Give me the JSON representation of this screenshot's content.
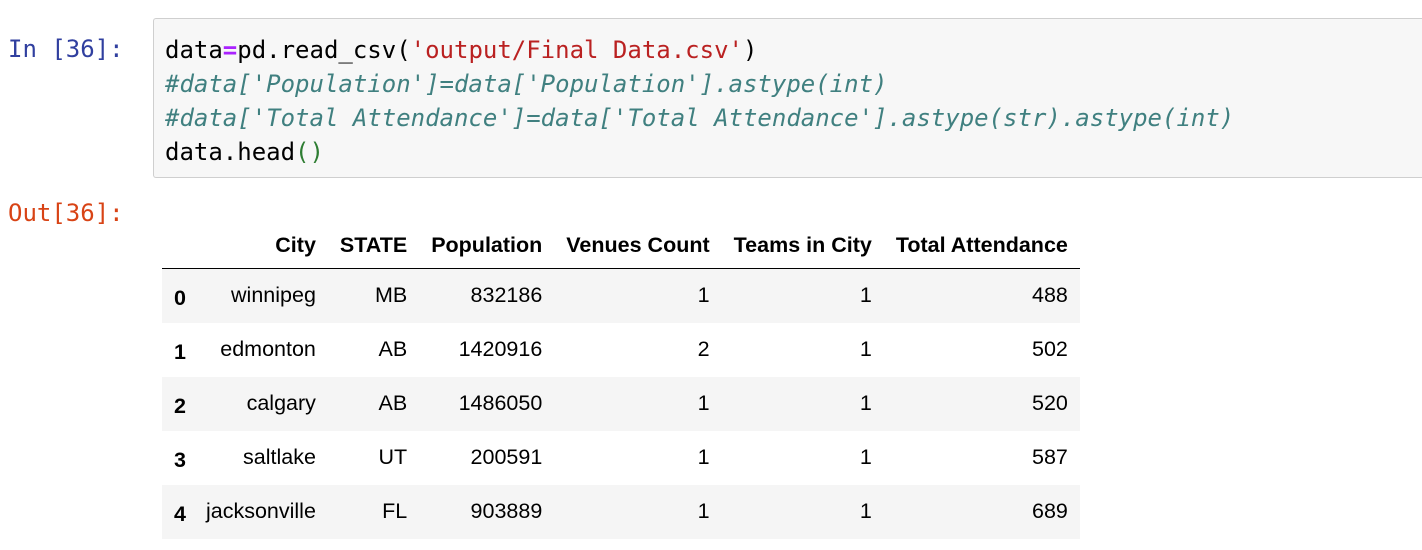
{
  "cell": {
    "in_prompt": "In [36]:",
    "out_prompt": "Out[36]:",
    "code": {
      "line1": {
        "a": "data",
        "op": "=",
        "b": "pd.read_csv(",
        "str": "'output/Final Data.csv'",
        "c": ")"
      },
      "line2": "#data['Population']=data['Population'].astype(int)",
      "line3": "#data['Total Attendance']=data['Total Attendance'].astype(str).astype(int)",
      "line4": {
        "a": "data.head",
        "paren": "()"
      }
    }
  },
  "table": {
    "columns": [
      "",
      "City",
      "STATE",
      "Population",
      "Venues Count",
      "Teams in City",
      "Total Attendance"
    ],
    "rows": [
      [
        "0",
        "winnipeg",
        "MB",
        "832186",
        "1",
        "1",
        "488"
      ],
      [
        "1",
        "edmonton",
        "AB",
        "1420916",
        "2",
        "1",
        "502"
      ],
      [
        "2",
        "calgary",
        "AB",
        "1486050",
        "1",
        "1",
        "520"
      ],
      [
        "3",
        "saltlake",
        "UT",
        "200591",
        "1",
        "1",
        "587"
      ],
      [
        "4",
        "jacksonville",
        "FL",
        "903889",
        "1",
        "1",
        "689"
      ]
    ]
  }
}
